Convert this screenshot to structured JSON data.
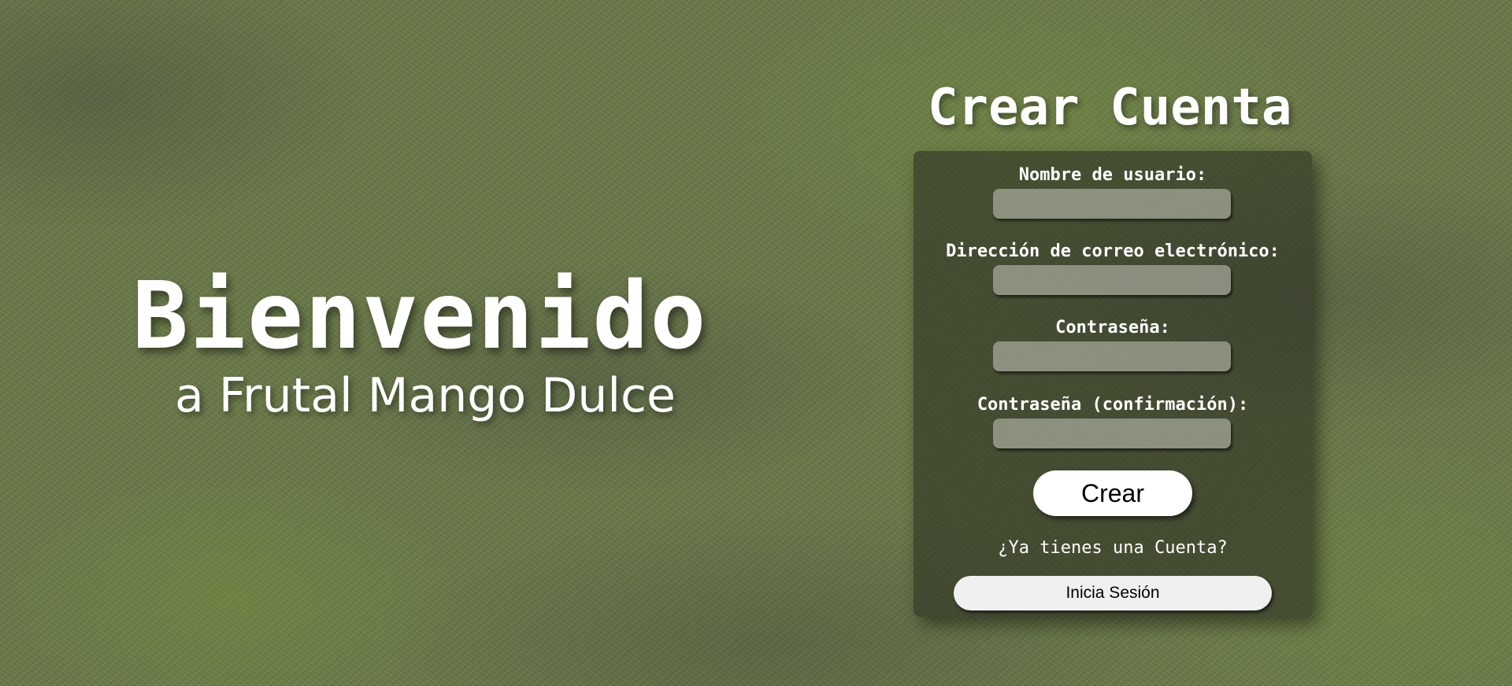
{
  "welcome": {
    "title": "Bienvenido",
    "subtitle": "a Frutal Mango Dulce"
  },
  "signup": {
    "title": "Crear Cuenta",
    "fields": [
      {
        "label": "Nombre de usuario:",
        "value": ""
      },
      {
        "label": "Dirección de correo electrónico:",
        "value": ""
      },
      {
        "label": "Contraseña:",
        "value": ""
      },
      {
        "label": "Contraseña (confirmación):",
        "value": ""
      }
    ],
    "submit_label": "Crear",
    "have_account_text": "¿Ya tienes una Cuenta?",
    "login_label": "Inicia Sesión"
  },
  "colors": {
    "background": "#6b7a4a",
    "card": "#2d3223",
    "input": "#c8c8be",
    "text": "#ffffff"
  }
}
